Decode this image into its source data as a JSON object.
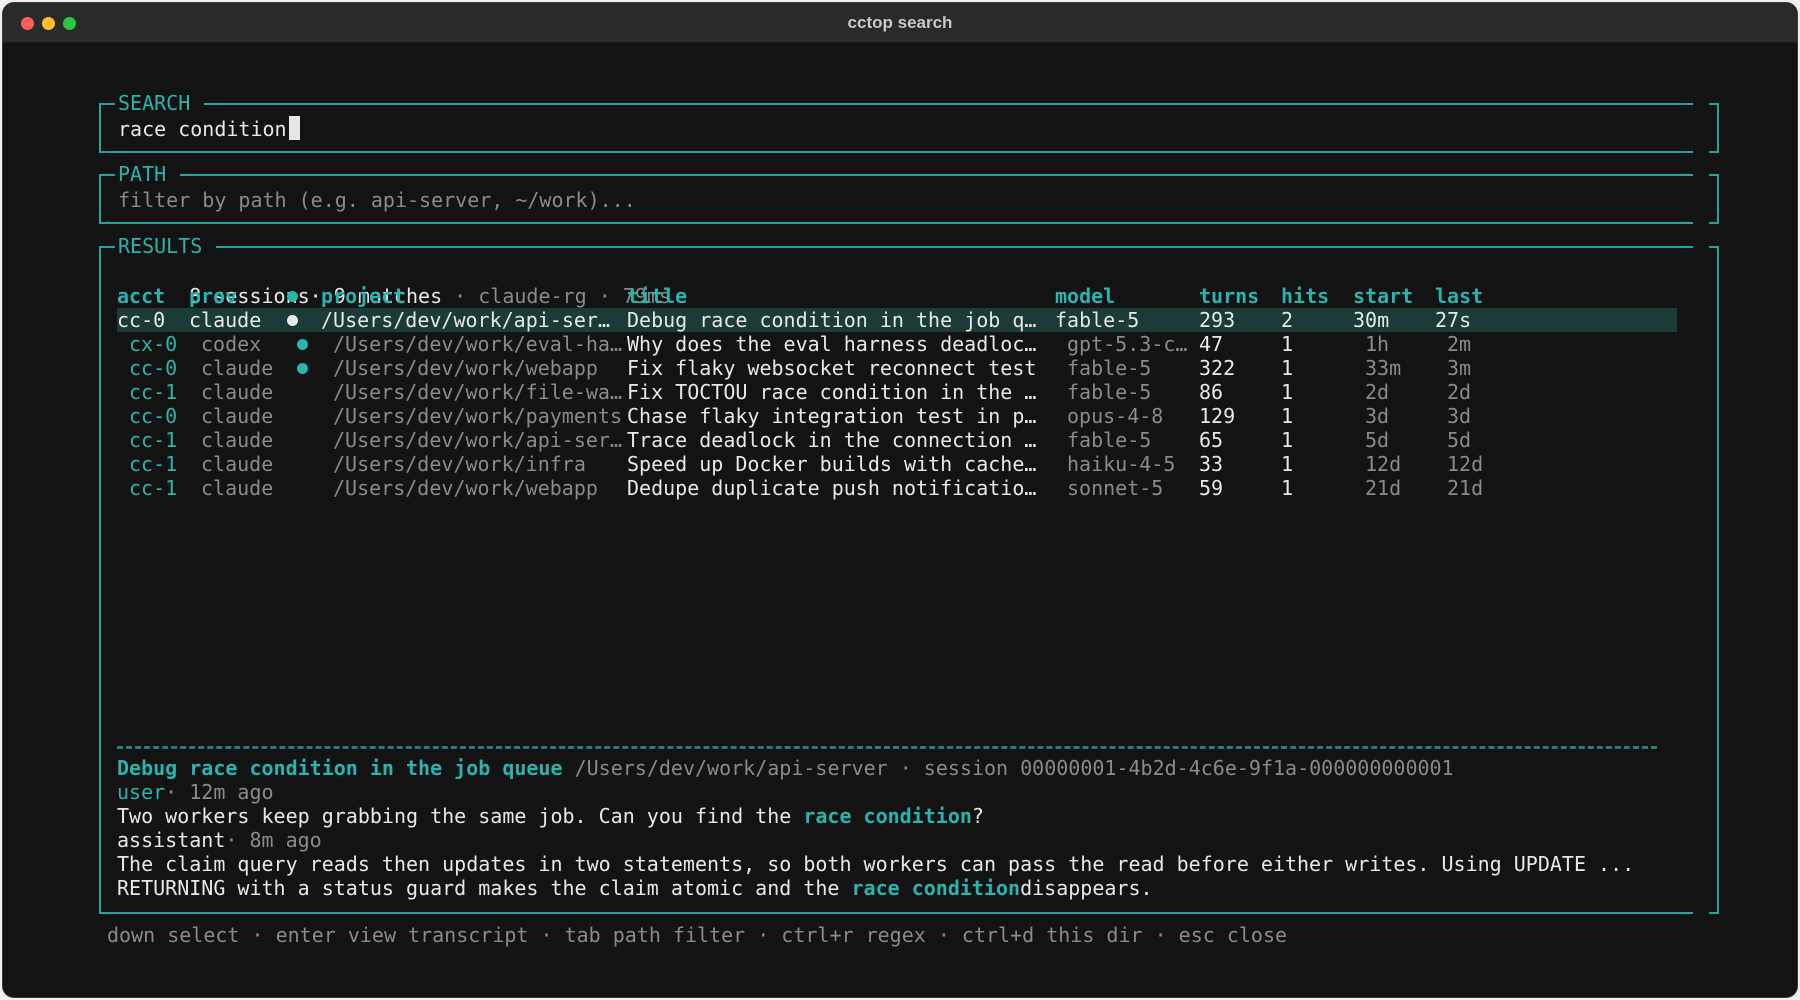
{
  "window": {
    "title": "cctop search"
  },
  "search": {
    "label": "SEARCH",
    "value": "race condition"
  },
  "path": {
    "label": "PATH",
    "placeholder": "filter by path (e.g. api-server, ~/work)..."
  },
  "results": {
    "label": "RESULTS",
    "summary": {
      "count": "8 sessions· 9 matches",
      "sep1": "·",
      "engine": "claude-rg",
      "sep2": "·",
      "time": "79ms"
    },
    "headers": {
      "acct": "acct",
      "prov": "prov",
      "project": "project",
      "title": "title",
      "model": "model",
      "turns": "turns",
      "hits": "hits",
      "start": "start",
      "last": "last"
    },
    "rows": [
      {
        "acct": "cc-0",
        "prov": "claude",
        "dot": true,
        "project": "/Users/dev/work/api-ser…",
        "title": "Debug race condition in the job q…",
        "model": "fable-5",
        "turns": "293",
        "hits": "2",
        "start": "30m",
        "last": "27s",
        "selected": true
      },
      {
        "acct": "cx-0",
        "prov": "codex",
        "dot": true,
        "project": "/Users/dev/work/eval-ha…",
        "title": "Why does the eval harness deadloc…",
        "model": "gpt-5.3-c…",
        "turns": "47",
        "hits": "1",
        "start": "1h",
        "last": "2m"
      },
      {
        "acct": "cc-0",
        "prov": "claude",
        "dot": true,
        "project": "/Users/dev/work/webapp",
        "title": "Fix flaky websocket reconnect test",
        "model": "fable-5",
        "turns": "322",
        "hits": "1",
        "start": "33m",
        "last": "3m"
      },
      {
        "acct": "cc-1",
        "prov": "claude",
        "dot": false,
        "project": "/Users/dev/work/file-wa…",
        "title": "Fix TOCTOU race condition in the …",
        "model": "fable-5",
        "turns": "86",
        "hits": "1",
        "start": "2d",
        "last": "2d"
      },
      {
        "acct": "cc-0",
        "prov": "claude",
        "dot": false,
        "project": "/Users/dev/work/payments",
        "title": "Chase flaky integration test in p…",
        "model": "opus-4-8",
        "turns": "129",
        "hits": "1",
        "start": "3d",
        "last": "3d"
      },
      {
        "acct": "cc-1",
        "prov": "claude",
        "dot": false,
        "project": "/Users/dev/work/api-ser…",
        "title": "Trace deadlock in the connection …",
        "model": "fable-5",
        "turns": "65",
        "hits": "1",
        "start": "5d",
        "last": "5d"
      },
      {
        "acct": "cc-1",
        "prov": "claude",
        "dot": false,
        "project": "/Users/dev/work/infra",
        "title": "Speed up Docker builds with cache…",
        "model": "haiku-4-5",
        "turns": "33",
        "hits": "1",
        "start": "12d",
        "last": "12d"
      },
      {
        "acct": "cc-1",
        "prov": "claude",
        "dot": false,
        "project": "/Users/dev/work/webapp",
        "title": "Dedupe duplicate push notificatio…",
        "model": "sonnet-5",
        "turns": "59",
        "hits": "1",
        "start": "21d",
        "last": "21d"
      }
    ]
  },
  "preview": {
    "title": "Debug race condition in the job queue",
    "path": "/Users/dev/work/api-server",
    "sep": "·",
    "session": "session 00000001-4b2d-4c6e-9f1a-000000000001",
    "user_role": "user",
    "user_time": "· 12m ago",
    "user_msg_pre": "Two workers keep grabbing the same job. Can you find the ",
    "user_msg_hl": "race condition",
    "user_msg_post": "?",
    "assistant_role": "assistant",
    "assistant_time": "· 8m ago",
    "assistant_line1": "The claim query reads then updates in two statements, so both workers can pass the read before either writes. Using UPDATE ...",
    "assistant_line2_pre": "RETURNING with a status guard makes the claim atomic and the ",
    "assistant_line2_hl": "race condition",
    "assistant_line2_post": "disappears."
  },
  "footer": "down select · enter view transcript · tab path filter · ctrl+r regex · ctrl+d this dir · esc close",
  "colors": {
    "accent": "#2bb3ad",
    "background": "#131313",
    "selected_row": "#1b3a38"
  }
}
